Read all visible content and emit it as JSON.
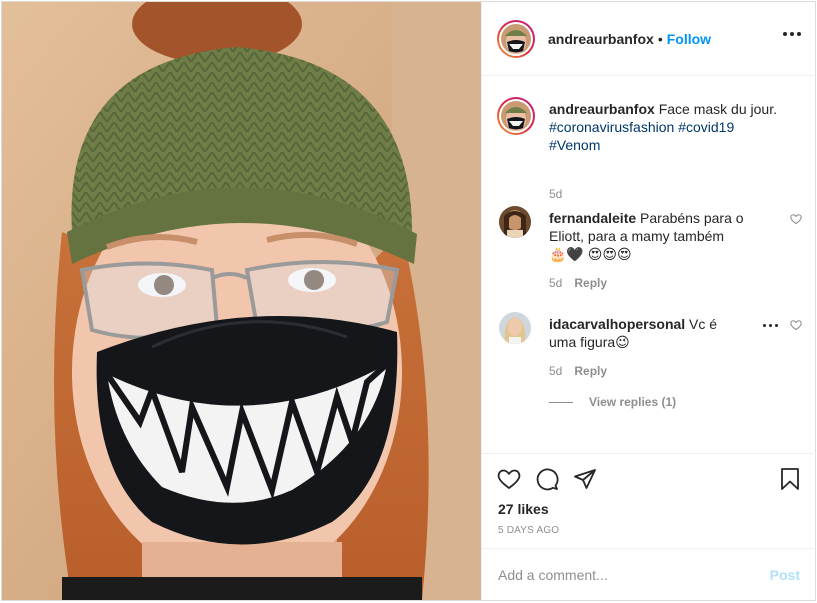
{
  "post": {
    "author": "andreaurbanfox",
    "follow_label": "Follow",
    "separator": "•",
    "caption": {
      "username": "andreaurbanfox",
      "text": " Face mask du jour.",
      "hashtags": [
        "#coronavirusfashion",
        "#covid19",
        "#Venom"
      ],
      "time": "5d"
    },
    "comments": [
      {
        "username": "fernandaleite",
        "text": " Parabéns para o Eliott, para a mamy também 🎂🖤 😍😍😍",
        "time": "5d",
        "reply_label": "Reply"
      },
      {
        "username": "idacarvalhopersonal",
        "text": " Vc é uma figura😉",
        "time": "5d",
        "reply_label": "Reply"
      }
    ],
    "view_replies_label": "View replies (1)",
    "likes": "27 likes",
    "ago": "5 DAYS AGO",
    "add_comment_placeholder": "Add a comment...",
    "post_label": "Post"
  },
  "icons": {
    "more": "more-horizontal-icon",
    "heart": "heart-icon",
    "comment": "comment-icon",
    "share": "share-icon",
    "bookmark": "bookmark-icon"
  },
  "colors": {
    "follow": "#0095f6",
    "post_disabled": "#b2dffc",
    "muted": "#8e8e8e",
    "hashtag": "#00376b"
  }
}
